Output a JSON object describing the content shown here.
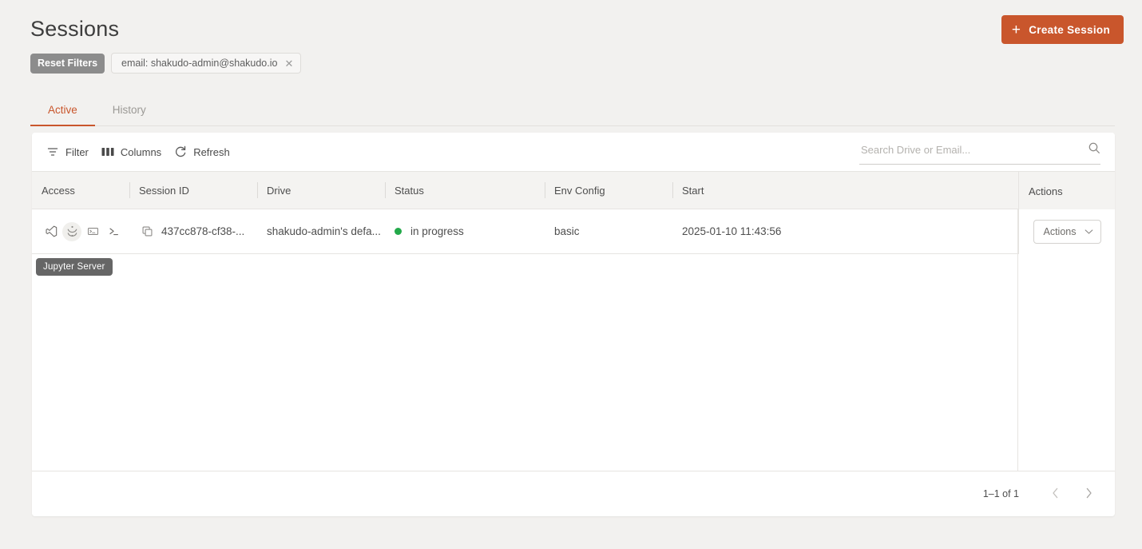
{
  "header": {
    "title": "Sessions",
    "create_button": {
      "label": "Create Session",
      "icon": "plus-icon",
      "color": "#c9562c"
    }
  },
  "filters": {
    "reset_label": "Reset Filters",
    "chips": [
      {
        "label": "email: shakudo-admin@shakudo.io",
        "remove_icon": "close-icon"
      }
    ]
  },
  "tabs": [
    {
      "label": "Active",
      "active": true
    },
    {
      "label": "History",
      "active": false
    }
  ],
  "toolbar": {
    "filter_label": "Filter",
    "columns_label": "Columns",
    "refresh_label": "Refresh",
    "icons": [
      "filter-icon",
      "columns-icon",
      "refresh-icon"
    ]
  },
  "search": {
    "placeholder": "Search Drive or Email...",
    "value": "",
    "icon": "search-icon"
  },
  "table": {
    "columns": [
      "Access",
      "Session ID",
      "Drive",
      "Status",
      "Env Config",
      "Start"
    ],
    "pinned_column": "Actions",
    "rows": [
      {
        "access_icons": [
          "vscode-icon",
          "jupyter-icon",
          "terminal-box-icon",
          "shell-prompt-icon"
        ],
        "copy_icon": "copy-icon",
        "session_id": "437cc878-cf38-...",
        "drive": "shakudo-admin's defa...",
        "status": "in progress",
        "status_color": "#23a94a",
        "env_config": "basic",
        "start": "2025-01-10 11:43:56",
        "actions_label": "Actions",
        "actions_icon": "chevron-down-icon"
      }
    ]
  },
  "tooltip": {
    "text": "Jupyter Server"
  },
  "pagination": {
    "range_label": "1–1 of 1",
    "prev_icon": "chevron-left-icon",
    "next_icon": "chevron-right-icon"
  }
}
